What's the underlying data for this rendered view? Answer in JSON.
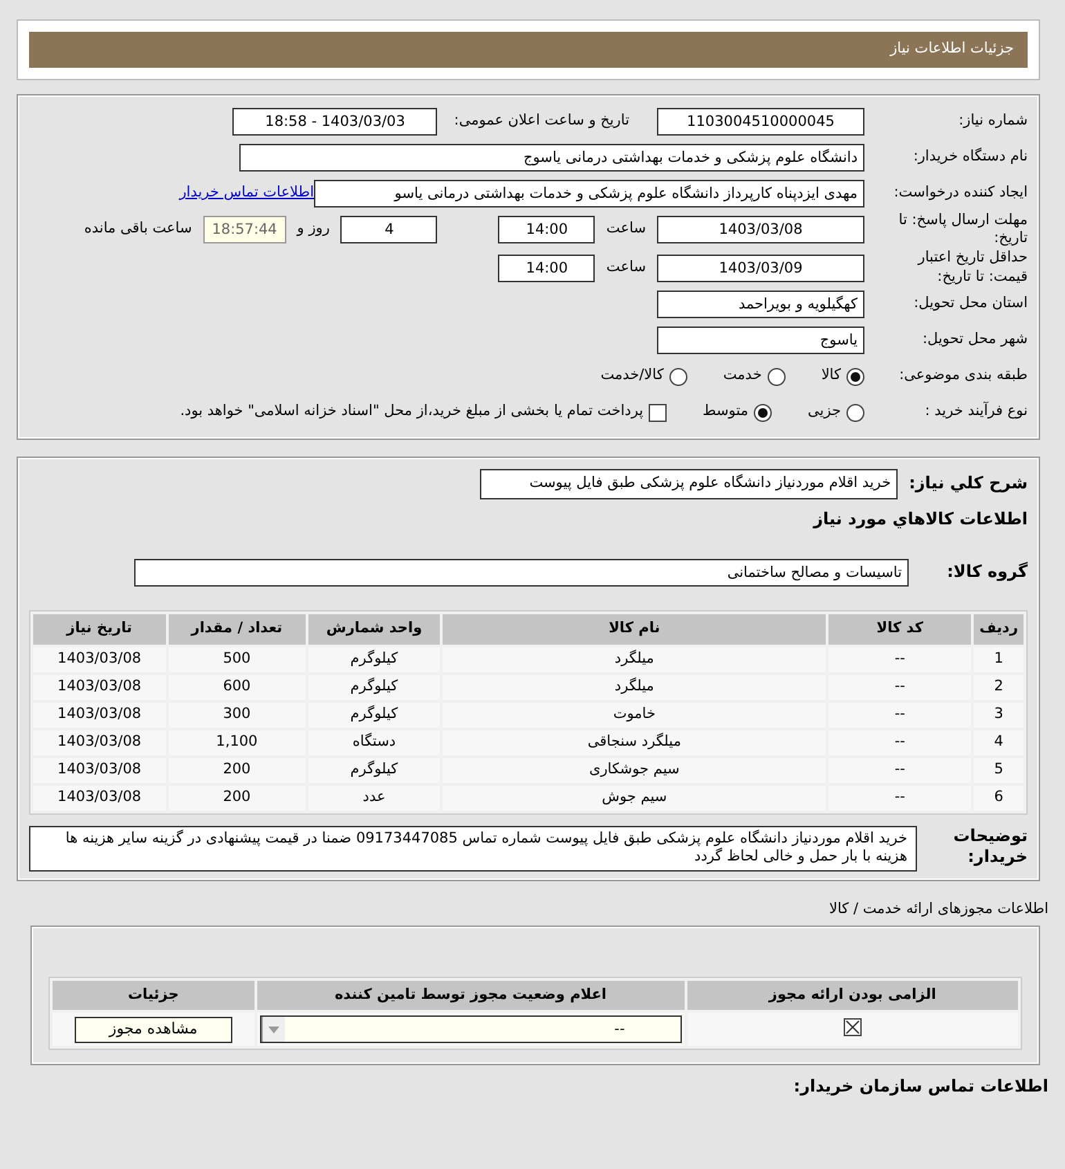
{
  "header": {
    "title": "جزئیات اطلاعات نیاز"
  },
  "need_info": {
    "need_number": {
      "label": "شماره نیاز:",
      "value": "1103004510000045"
    },
    "announce_datetime": {
      "label": "تاریخ و ساعت اعلان عمومی:",
      "value": "1403/03/03 - 18:58"
    },
    "buyer_org": {
      "label": "نام دستگاه خریدار:",
      "value": "دانشگاه علوم پزشکی و خدمات بهداشتی  درمانی یاسوج"
    },
    "requester": {
      "label": "ایجاد کننده درخواست:",
      "value": "مهدی ایزدپناه کارپرداز دانشگاه علوم پزشکی و خدمات بهداشتی  درمانی یاسو",
      "link": "اطلاعات تماس خریدار"
    },
    "response_deadline": {
      "label": "مهلت ارسال پاسخ: تا تاریخ:",
      "date": "1403/03/08",
      "time_label": "ساعت",
      "time": "14:00",
      "days": "4",
      "days_label": "روز و",
      "remaining": "18:57:44",
      "remaining_label": "ساعت باقی مانده"
    },
    "price_validity": {
      "label": "حداقل تاریخ اعتبار قیمت: تا تاریخ:",
      "date": "1403/03/09",
      "time_label": "ساعت",
      "time": "14:00"
    },
    "province": {
      "label": "استان محل تحویل:",
      "value": "کهگیلویه و بویراحمد"
    },
    "city": {
      "label": "شهر محل تحویل:",
      "value": "یاسوج"
    },
    "category": {
      "label": "طبقه بندی موضوعی:",
      "options": [
        {
          "label": "کالا",
          "selected": true
        },
        {
          "label": "خدمت",
          "selected": false
        },
        {
          "label": "کالا/خدمت",
          "selected": false
        }
      ]
    },
    "purchase_process": {
      "label": "نوع فرآیند خرید :",
      "options": [
        {
          "label": "جزیی",
          "selected": false
        },
        {
          "label": "متوسط",
          "selected": true
        }
      ],
      "payment_option": {
        "label": "پرداخت تمام یا بخشی از مبلغ خرید،از محل \"اسناد خزانه اسلامی\" خواهد بود.",
        "checked": false
      }
    }
  },
  "goods": {
    "description": {
      "label": "شرح کلي نياز:",
      "value": "خرید اقلام موردنیاز دانشگاه علوم پزشکی طبق فایل پیوست"
    },
    "heading": "اطلاعات کالاهاي مورد نياز",
    "group": {
      "label": "گروه کالا:",
      "value": "تاسیسات و مصالح ساختمانی"
    },
    "table": {
      "columns": [
        "ردیف",
        "کد کالا",
        "نام کالا",
        "واحد شمارش",
        "تعداد / مقدار",
        "تاریخ نیاز"
      ],
      "rows": [
        [
          "1",
          "--",
          "میلگرد",
          "کیلوگرم",
          "500",
          "1403/03/08"
        ],
        [
          "2",
          "--",
          "میلگرد",
          "کیلوگرم",
          "600",
          "1403/03/08"
        ],
        [
          "3",
          "--",
          "خاموت",
          "کیلوگرم",
          "300",
          "1403/03/08"
        ],
        [
          "4",
          "--",
          "میلگرد سنجاقی",
          "دستگاه",
          "1,100",
          "1403/03/08"
        ],
        [
          "5",
          "--",
          "سیم جوشکاری",
          "کیلوگرم",
          "200",
          "1403/03/08"
        ],
        [
          "6",
          "--",
          "سیم جوش",
          "عدد",
          "200",
          "1403/03/08"
        ]
      ]
    },
    "buyer_notes": {
      "label": "توضیحات خریدار:",
      "value": "خرید اقلام موردنیاز دانشگاه علوم پزشکی طبق فایل پیوست شماره تماس 09173447085 ضمنا در قیمت پیشنهادی در گزینه سایر هزینه ها هزینه با بار حمل و خالی لحاظ گردد"
    }
  },
  "licenses": {
    "title": "اطلاعات مجوزهای ارائه خدمت / کالا",
    "columns": [
      "الزامی بودن ارائه مجوز",
      "اعلام وضعیت مجوز توسط تامین کننده",
      "جزئیات"
    ],
    "rows": [
      {
        "required": true,
        "status": "--",
        "button": "مشاهده مجوز"
      }
    ]
  },
  "contact_heading": "اطلاعات تماس سازمان خریدار:"
}
